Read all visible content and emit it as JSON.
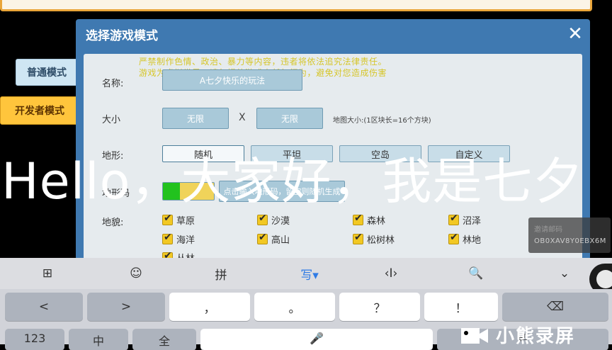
{
  "side_menu": {
    "normal_mode": "普通模式",
    "developer_mode": "开发者模式"
  },
  "dialog": {
    "title": "选择游戏模式",
    "close": "✕",
    "warning_line1": "严禁制作色情、政治、暴力等内容，违者将依法追究法律责任。",
    "warning_line2": "游戏为虚拟世界，请勿模仿游戏内任何行为，避免对您造成伤害",
    "name_label": "名称:",
    "name_value": "A七夕快乐的玩法",
    "size_label": "大小",
    "size_w": "无限",
    "size_x": "X",
    "size_h": "无限",
    "map_hint": "地图大小:(1区块长=16个方块)",
    "terrain_label": "地形:",
    "terrain_options": [
      "随机",
      "平坦",
      "空岛",
      "自定义"
    ],
    "seed_label": "地形码",
    "seed_placeholder": "点击输入地形码，留空则随机生成",
    "landform_label": "地貌:",
    "landforms": [
      "草原",
      "沙漠",
      "森林",
      "沼泽",
      "海洋",
      "高山",
      "松树林",
      "林地",
      "丛林"
    ]
  },
  "overlay_caption": "Hello，大家好，我是七夕",
  "invite": {
    "label": "邀请邮码",
    "code": "OB0XAV8Y0EBX6M"
  },
  "keyboard_toolbar": [
    "⊞",
    "☺",
    "拼",
    "写▾",
    "‹I›",
    "🔍",
    "⌄"
  ],
  "keyboard": {
    "row1": [
      "<",
      ">",
      "，",
      "。",
      "？",
      "！",
      "⌫"
    ],
    "row2": [
      "123",
      "中",
      "全",
      "🎤",
      "⏎"
    ]
  },
  "watermark": "小熊录屏",
  "colors": {
    "dialog_blue": "#3f79b1",
    "accent_orange": "#ffc53c",
    "check_yellow": "#f2c823",
    "toggle_green": "#22c21e"
  }
}
